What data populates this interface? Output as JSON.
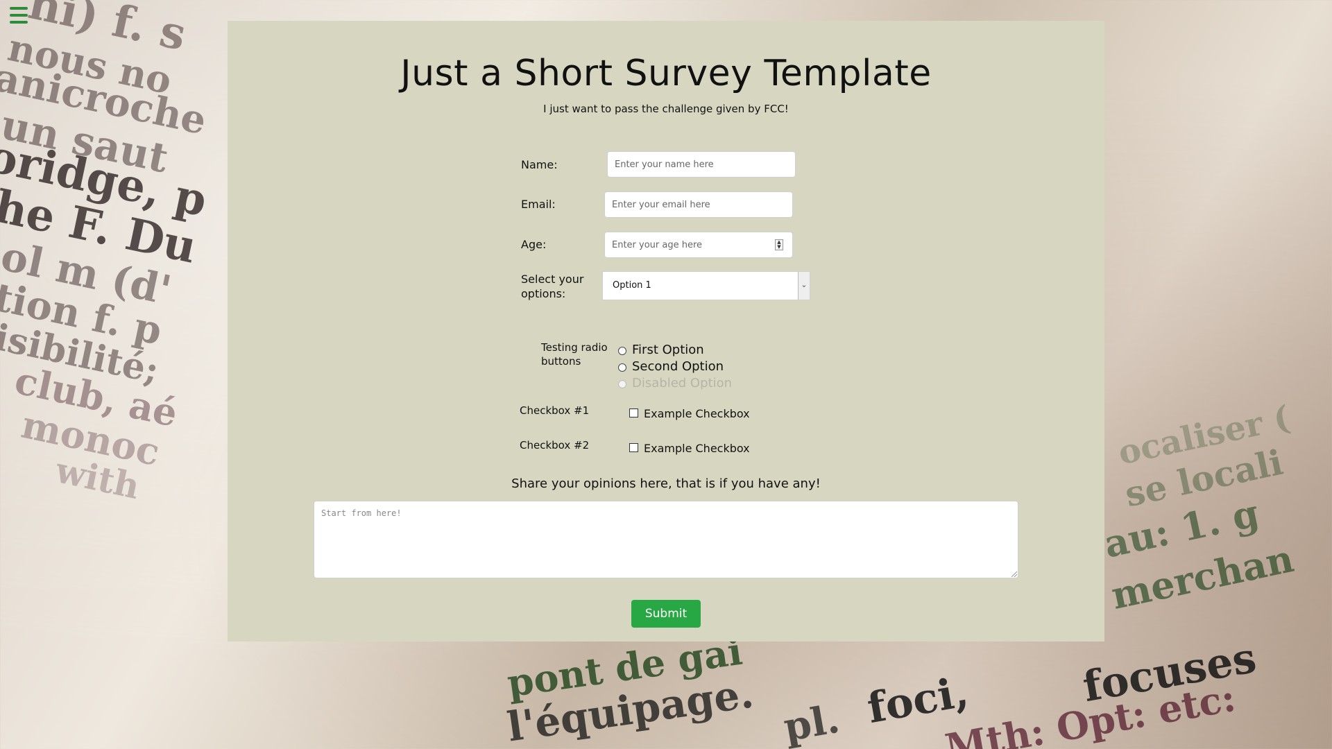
{
  "menu": {
    "icon": "hamburger-menu-icon",
    "color": "#2e8b3a"
  },
  "survey": {
    "title": "Just a Short Survey Template",
    "subtitle": "I just want to pass the challenge given by FCC!",
    "background_color": "#d7d7c1"
  },
  "form": {
    "name": {
      "label": "Name:",
      "placeholder": "Enter your name here"
    },
    "email": {
      "label": "Email:",
      "placeholder": "Enter your email here"
    },
    "age": {
      "label": "Age:",
      "placeholder": "Enter your age here"
    },
    "options": {
      "label_line1": "Select your",
      "label_line2": "options:",
      "selected": "Option 1"
    },
    "radio": {
      "label_line1": "Testing radio",
      "label_line2": "buttons",
      "items": [
        {
          "label": "First Option",
          "disabled": false
        },
        {
          "label": "Second Option",
          "disabled": false
        },
        {
          "label": "Disabled Option",
          "disabled": true
        }
      ]
    },
    "checkboxes": [
      {
        "label": "Checkbox #1",
        "text": "Example Checkbox",
        "checked": false
      },
      {
        "label": "Checkbox #2",
        "text": "Example Checkbox",
        "checked": false
      }
    ],
    "opinion": {
      "label": "Share your opinions here, that is if you have any!",
      "placeholder": "Start from here!"
    },
    "submit_label": "Submit",
    "submit_color": "#28a745"
  },
  "background_words": [
    "ni) f. s",
    "nous no",
    "anicroche",
    "un saut",
    "oridge, p",
    "he F. Du",
    "ol m (d'",
    "tion f. p",
    "isibilité;",
    "club, aé",
    "monoc",
    "with",
    "pont de gai",
    "l'équipage.",
    "foci,",
    "focuses",
    "Mth: Opt: etc:",
    "merchan",
    "au: 1. g",
    "se locali",
    "ocaliser (",
    "pl."
  ]
}
